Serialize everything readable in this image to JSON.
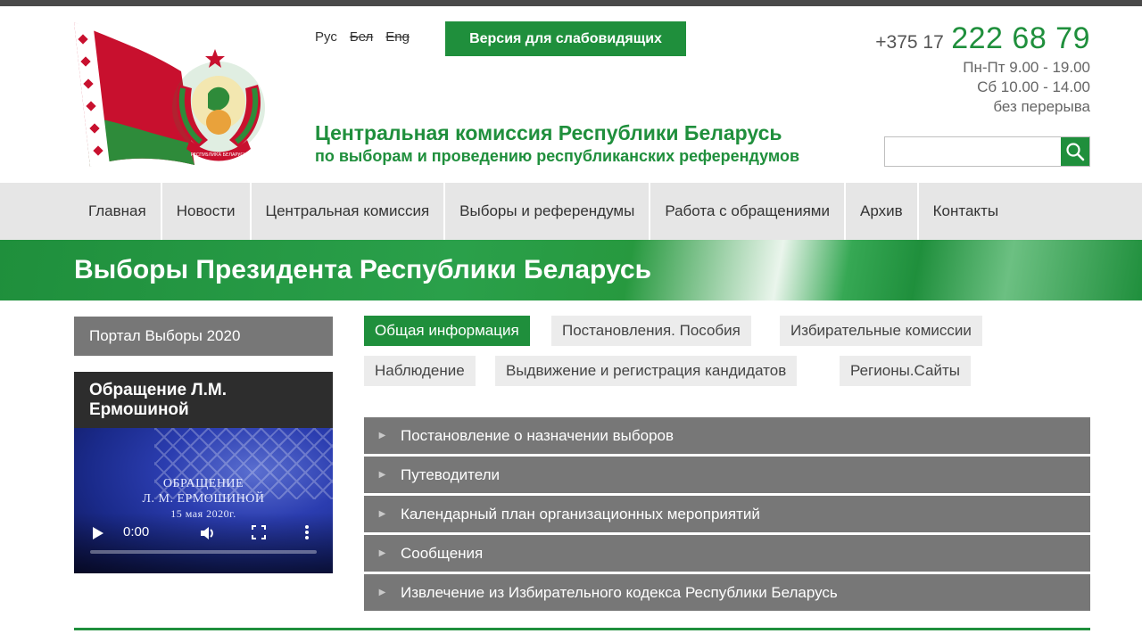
{
  "header": {
    "langs": [
      "Рус",
      "Бел",
      "Eng"
    ],
    "low_vision_label": "Версия для слабовидящих",
    "title_line1": "Центральная комиссия Республики Беларусь",
    "title_line2": "по выборам и проведению республиканских референдумов",
    "phone_code": "+375 17",
    "phone_number": "222 68 79",
    "hours": [
      "Пн-Пт 9.00 - 19.00",
      "Сб 10.00 - 14.00",
      "без перерыва"
    ],
    "search_placeholder": "",
    "logo_ribbon_text": "РЕСПУБЛИКА БЕЛАРУСЬ"
  },
  "nav": {
    "items": [
      "Главная",
      "Новости",
      "Центральная комиссия",
      "Выборы и референдумы",
      "Работа с обращениями",
      "Архив",
      "Контакты"
    ]
  },
  "banner": {
    "title": "Выборы Президента Республики Беларусь"
  },
  "sidebar": {
    "portal_label": "Портал Выборы 2020",
    "video": {
      "title": "Обращение Л.М. Ермошиной",
      "caption_line1": "ОБРАЩЕНИЕ",
      "caption_line2": "Л. М. ЕРМОШИНОЙ",
      "caption_date": "15 мая 2020г.",
      "time": "0:00",
      "progress": 0
    }
  },
  "tabs": [
    {
      "label": "Общая информация",
      "active": true
    },
    {
      "label": "Постановления. Пособия",
      "active": false
    },
    {
      "label": "Избирательные комиссии",
      "active": false
    },
    {
      "label": "Наблюдение",
      "active": false
    },
    {
      "label": "Выдвижение и регистрация кандидатов",
      "active": false
    },
    {
      "label": "Регионы.Сайты",
      "active": false
    }
  ],
  "accordion": [
    "Постановление о назначении выборов",
    "Путеводители",
    "Календарный план организационных мероприятий",
    "Сообщения",
    "Извлечение из Избирательного кодекса Республики Беларусь"
  ],
  "colors": {
    "accent": "#1f8f3c",
    "gray": "#777777",
    "nav_bg": "#e6e6e6"
  },
  "icons": [
    "flag-emblem-logo",
    "search-icon",
    "play-icon",
    "volume-icon",
    "fullscreen-icon",
    "more-vertical-icon",
    "chevron-right-icon"
  ]
}
